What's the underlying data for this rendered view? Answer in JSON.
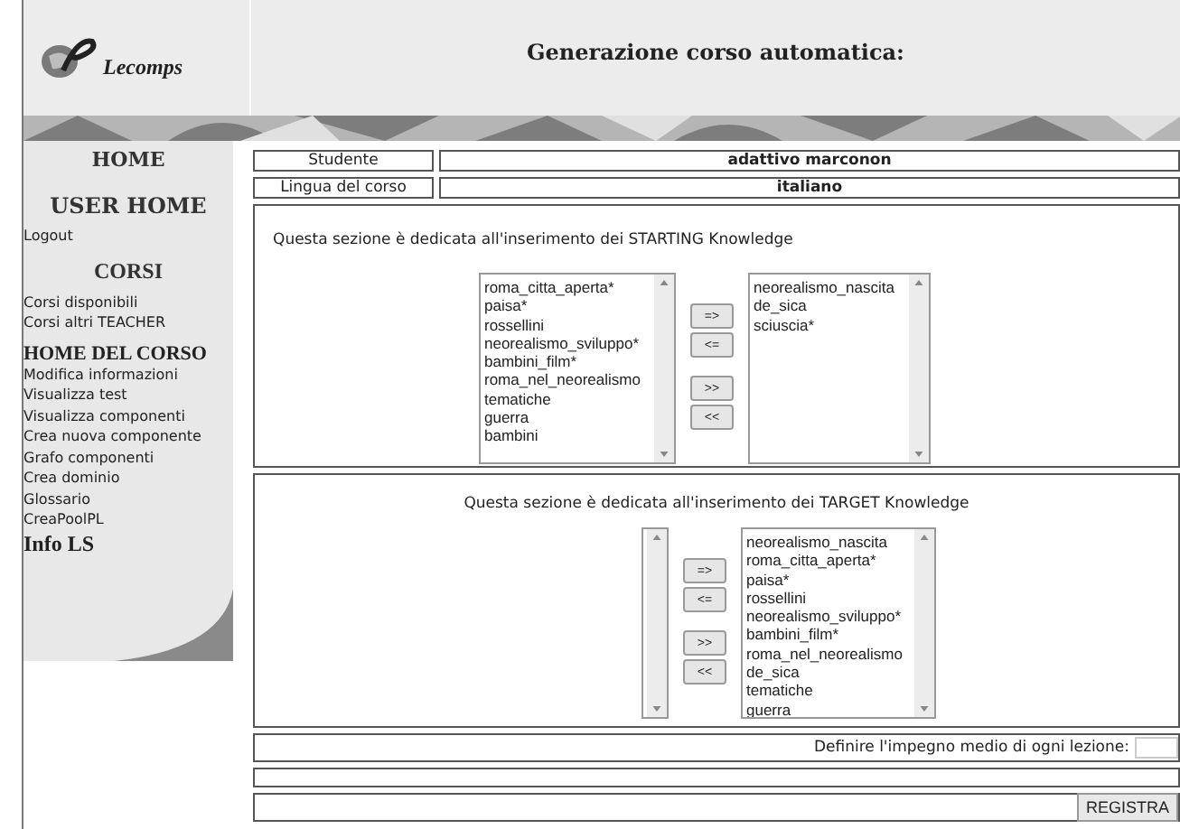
{
  "header": {
    "logo_text": "Lecomps",
    "title": "Generazione corso automatica:"
  },
  "sidebar": {
    "items": [
      {
        "kind": "title",
        "label": "HOME"
      },
      {
        "kind": "title",
        "label": "USER HOME"
      },
      {
        "kind": "link",
        "label": "Logout"
      },
      {
        "kind": "title-serif",
        "label": "CORSI"
      },
      {
        "kind": "link",
        "label": "Corsi disponibili"
      },
      {
        "kind": "link",
        "label": "Corsi altri TEACHER"
      },
      {
        "kind": "heading",
        "label": "HOME DEL CORSO"
      },
      {
        "kind": "link",
        "label": "Modifica informazioni"
      },
      {
        "kind": "link",
        "label": "Visualizza test"
      },
      {
        "kind": "link",
        "label": "Visualizza componenti"
      },
      {
        "kind": "link",
        "label": "Crea nuova componente"
      },
      {
        "kind": "link",
        "label": "Grafo componenti"
      },
      {
        "kind": "link",
        "label": "Crea dominio"
      },
      {
        "kind": "link",
        "label": "Glossario"
      },
      {
        "kind": "link",
        "label": "CreaPoolPL"
      },
      {
        "kind": "heading-serif",
        "label": "Info LS"
      }
    ]
  },
  "info_rows": [
    {
      "label": "Studente",
      "value": "adattivo marconon"
    },
    {
      "label": "Lingua del corso",
      "value": "italiano"
    }
  ],
  "sections": [
    {
      "kind": "left",
      "intro": "Questa sezione è dedicata all'inserimento dei STARTING Knowledge",
      "available": [
        "roma_citta_aperta*",
        "paisa*",
        "rossellini",
        "neorealismo_sviluppo*",
        "bambini_film*",
        "roma_nel_neorealismo",
        "tematiche",
        "guerra",
        "bambini"
      ],
      "buttons": [
        "=>",
        "<=",
        ">>",
        "<<"
      ],
      "chosen": [
        "neorealismo_nascita",
        "de_sica",
        "sciuscia*"
      ]
    },
    {
      "kind": "center",
      "intro": "Questa sezione è dedicata all'inserimento dei TARGET Knowledge",
      "buttons": [
        "=>",
        "<=",
        ">>",
        "<<"
      ],
      "chosen": [
        "neorealismo_nascita",
        "roma_citta_aperta*",
        "paisa*",
        "rossellini",
        "neorealismo_sviluppo*",
        "bambini_film*",
        "roma_nel_neorealismo",
        "de_sica",
        "tematiche",
        "guerra"
      ]
    }
  ],
  "effort": {
    "label": "Definire l'impegno medio di ogni lezione:"
  },
  "submit": "REGISTRA"
}
